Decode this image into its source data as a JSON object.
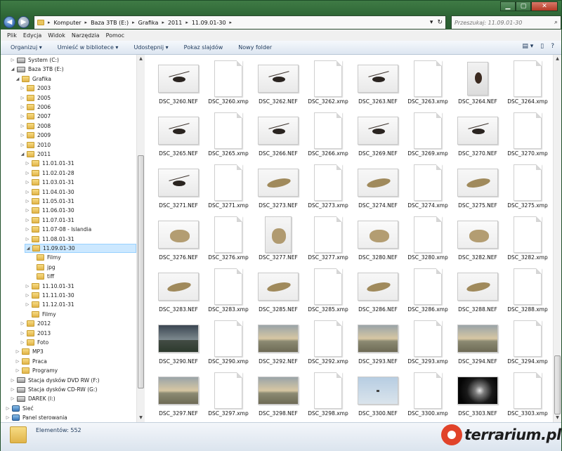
{
  "window": {
    "min": "▁",
    "max": "▢",
    "close": "✕"
  },
  "address": {
    "crumbs": [
      "Komputer",
      "Baza 3TB (E:)",
      "Grafika",
      "2011",
      "11.09.01-30"
    ],
    "search_placeholder": "Przeszukaj: 11.09.01-30"
  },
  "menu": [
    "Plik",
    "Edycja",
    "Widok",
    "Narzędzia",
    "Pomoc"
  ],
  "toolbar": [
    "Organizuj ▾",
    "Umieść w bibliotece ▾",
    "Udostępnij ▾",
    "Pokaz slajdów",
    "Nowy folder"
  ],
  "tree": [
    {
      "label": "System (C:)",
      "indent": 2,
      "icon": "drive",
      "arrow": "▷"
    },
    {
      "label": "Baza 3TB (E:)",
      "indent": 2,
      "icon": "drive",
      "arrow": "◢"
    },
    {
      "label": "Grafika",
      "indent": 3,
      "icon": "folder",
      "arrow": "◢"
    },
    {
      "label": "2003",
      "indent": 4,
      "icon": "folder",
      "arrow": "▷"
    },
    {
      "label": "2005",
      "indent": 4,
      "icon": "folder",
      "arrow": "▷"
    },
    {
      "label": "2006",
      "indent": 4,
      "icon": "folder",
      "arrow": "▷"
    },
    {
      "label": "2007",
      "indent": 4,
      "icon": "folder",
      "arrow": "▷"
    },
    {
      "label": "2008",
      "indent": 4,
      "icon": "folder",
      "arrow": "▷"
    },
    {
      "label": "2009",
      "indent": 4,
      "icon": "folder",
      "arrow": "▷"
    },
    {
      "label": "2010",
      "indent": 4,
      "icon": "folder",
      "arrow": "▷"
    },
    {
      "label": "2011",
      "indent": 4,
      "icon": "folder",
      "arrow": "◢"
    },
    {
      "label": "11.01.01-31",
      "indent": 5,
      "icon": "folder",
      "arrow": "▷"
    },
    {
      "label": "11.02.01-28",
      "indent": 5,
      "icon": "folder",
      "arrow": "▷"
    },
    {
      "label": "11.03.01-31",
      "indent": 5,
      "icon": "folder",
      "arrow": "▷"
    },
    {
      "label": "11.04.01-30",
      "indent": 5,
      "icon": "folder",
      "arrow": "▷"
    },
    {
      "label": "11.05.01-31",
      "indent": 5,
      "icon": "folder",
      "arrow": "▷"
    },
    {
      "label": "11.06.01-30",
      "indent": 5,
      "icon": "folder",
      "arrow": "▷"
    },
    {
      "label": "11.07.01-31",
      "indent": 5,
      "icon": "folder",
      "arrow": "▷"
    },
    {
      "label": "11.07-08 - Islandia",
      "indent": 5,
      "icon": "folder",
      "arrow": "▷"
    },
    {
      "label": "11.08.01-31",
      "indent": 5,
      "icon": "folder",
      "arrow": "▷"
    },
    {
      "label": "11.09.01-30",
      "indent": 5,
      "icon": "folder",
      "arrow": "◢",
      "selected": true
    },
    {
      "label": "Filmy",
      "indent": 6,
      "icon": "folder",
      "arrow": ""
    },
    {
      "label": "jpg",
      "indent": 6,
      "icon": "folder",
      "arrow": ""
    },
    {
      "label": "tiff",
      "indent": 6,
      "icon": "folder",
      "arrow": ""
    },
    {
      "label": "11.10.01-31",
      "indent": 5,
      "icon": "folder",
      "arrow": "▷"
    },
    {
      "label": "11.11.01-30",
      "indent": 5,
      "icon": "folder",
      "arrow": "▷"
    },
    {
      "label": "11.12.01-31",
      "indent": 5,
      "icon": "folder",
      "arrow": "▷"
    },
    {
      "label": "Filmy",
      "indent": 5,
      "icon": "folder",
      "arrow": ""
    },
    {
      "label": "2012",
      "indent": 4,
      "icon": "folder",
      "arrow": "▷"
    },
    {
      "label": "2013",
      "indent": 4,
      "icon": "folder",
      "arrow": "▷"
    },
    {
      "label": "Foto",
      "indent": 4,
      "icon": "folder",
      "arrow": "▷"
    },
    {
      "label": "MP3",
      "indent": 3,
      "icon": "folder",
      "arrow": "▷"
    },
    {
      "label": "Praca",
      "indent": 3,
      "icon": "folder",
      "arrow": "▷"
    },
    {
      "label": "Programy",
      "indent": 3,
      "icon": "folder",
      "arrow": "▷"
    },
    {
      "label": "Stacja dysków DVD RW (F:)",
      "indent": 2,
      "icon": "drive",
      "arrow": "▷"
    },
    {
      "label": "Stacja dysków CD-RW (G:)",
      "indent": 2,
      "icon": "drive",
      "arrow": "▷"
    },
    {
      "label": "DAREK (I:)",
      "indent": 2,
      "icon": "drive",
      "arrow": "▷"
    },
    {
      "label": "Sieć",
      "indent": 1,
      "icon": "net",
      "arrow": "▷"
    },
    {
      "label": "Panel sterowania",
      "indent": 1,
      "icon": "net",
      "arrow": "▷"
    }
  ],
  "files": [
    [
      {
        "name": "DSC_3260.NEF",
        "kind": "cricket"
      },
      {
        "name": "DSC_3260.xmp",
        "kind": "doc"
      },
      {
        "name": "DSC_3262.NEF",
        "kind": "cricket"
      },
      {
        "name": "DSC_3262.xmp",
        "kind": "doc"
      },
      {
        "name": "DSC_3263.NEF",
        "kind": "cricket"
      },
      {
        "name": "DSC_3263.xmp",
        "kind": "doc"
      },
      {
        "name": "DSC_3264.NEF",
        "kind": "cricketv"
      },
      {
        "name": "DSC_3264.xmp",
        "kind": "doc"
      }
    ],
    [
      {
        "name": "DSC_3265.NEF",
        "kind": "cricket"
      },
      {
        "name": "DSC_3265.xmp",
        "kind": "doc"
      },
      {
        "name": "DSC_3266.NEF",
        "kind": "cricket"
      },
      {
        "name": "DSC_3266.xmp",
        "kind": "doc"
      },
      {
        "name": "DSC_3269.NEF",
        "kind": "cricket"
      },
      {
        "name": "DSC_3269.xmp",
        "kind": "doc"
      },
      {
        "name": "DSC_3270.NEF",
        "kind": "cricket"
      },
      {
        "name": "DSC_3270.xmp",
        "kind": "doc"
      }
    ],
    [
      {
        "name": "DSC_3271.NEF",
        "kind": "cricket"
      },
      {
        "name": "DSC_3271.xmp",
        "kind": "doc"
      },
      {
        "name": "DSC_3273.NEF",
        "kind": "lizard"
      },
      {
        "name": "DSC_3273.xmp",
        "kind": "doc"
      },
      {
        "name": "DSC_3274.NEF",
        "kind": "lizard"
      },
      {
        "name": "DSC_3274.xmp",
        "kind": "doc"
      },
      {
        "name": "DSC_3275.NEF",
        "kind": "lizard"
      },
      {
        "name": "DSC_3275.xmp",
        "kind": "doc"
      }
    ],
    [
      {
        "name": "DSC_3276.NEF",
        "kind": "toad"
      },
      {
        "name": "DSC_3276.xmp",
        "kind": "doc"
      },
      {
        "name": "DSC_3277.NEF",
        "kind": "toadv"
      },
      {
        "name": "DSC_3277.xmp",
        "kind": "doc"
      },
      {
        "name": "DSC_3280.NEF",
        "kind": "toad"
      },
      {
        "name": "DSC_3280.xmp",
        "kind": "doc"
      },
      {
        "name": "DSC_3282.NEF",
        "kind": "toad"
      },
      {
        "name": "DSC_3282.xmp",
        "kind": "doc"
      }
    ],
    [
      {
        "name": "DSC_3283.NEF",
        "kind": "lizard"
      },
      {
        "name": "DSC_3283.xmp",
        "kind": "doc"
      },
      {
        "name": "DSC_3285.NEF",
        "kind": "lizard"
      },
      {
        "name": "DSC_3285.xmp",
        "kind": "doc"
      },
      {
        "name": "DSC_3286.NEF",
        "kind": "lizard"
      },
      {
        "name": "DSC_3286.xmp",
        "kind": "doc"
      },
      {
        "name": "DSC_3288.NEF",
        "kind": "lizard"
      },
      {
        "name": "DSC_3288.xmp",
        "kind": "doc"
      }
    ],
    [
      {
        "name": "DSC_3290.NEF",
        "kind": "dawn"
      },
      {
        "name": "DSC_3290.xmp",
        "kind": "doc"
      },
      {
        "name": "DSC_3292.NEF",
        "kind": "dawn2"
      },
      {
        "name": "DSC_3292.xmp",
        "kind": "doc"
      },
      {
        "name": "DSC_3293.NEF",
        "kind": "dawn2"
      },
      {
        "name": "DSC_3293.xmp",
        "kind": "doc"
      },
      {
        "name": "DSC_3294.NEF",
        "kind": "dawn2"
      },
      {
        "name": "DSC_3294.xmp",
        "kind": "doc"
      }
    ],
    [
      {
        "name": "DSC_3297.NEF",
        "kind": "dawn2"
      },
      {
        "name": "DSC_3297.xmp",
        "kind": "doc"
      },
      {
        "name": "DSC_3298.NEF",
        "kind": "dawn2"
      },
      {
        "name": "DSC_3298.xmp",
        "kind": "doc"
      },
      {
        "name": "DSC_3300.NEF",
        "kind": "sky"
      },
      {
        "name": "DSC_3300.xmp",
        "kind": "doc"
      },
      {
        "name": "DSC_3303.NEF",
        "kind": "dark"
      },
      {
        "name": "DSC_3303.xmp",
        "kind": "doc"
      }
    ]
  ],
  "status": {
    "count": "Elementów: 552"
  },
  "watermark": {
    "text": "terrarium.pl"
  }
}
